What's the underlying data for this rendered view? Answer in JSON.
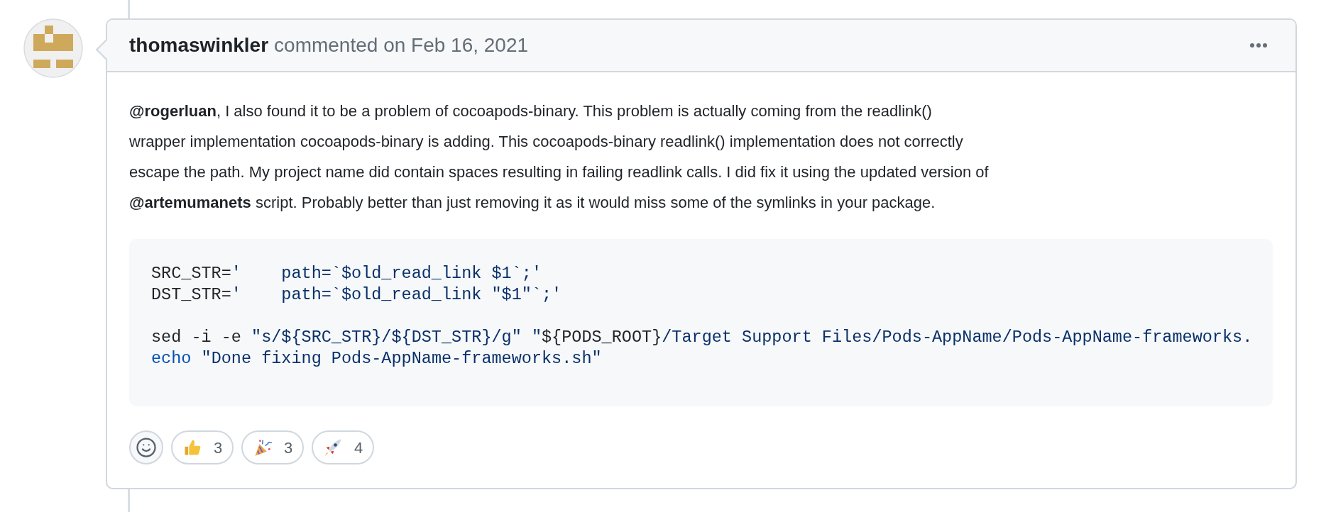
{
  "comment": {
    "author": "thomaswinkler",
    "action": "commented on Feb 16, 2021",
    "body": "**@rogerluan**, I also found it to be a problem of cocoapods-binary. This problem is actually coming from the readlink()\nwrapper implementation cocoapods-binary is adding. This cocoapods-binary readlink() implementation does not correctly\nescape the path. My project name did contain spaces resulting in failing readlink calls. I did fix it using the updated version of\n**@artemumanets** script. Probably better than just removing it as it would miss some of the symlinks in your package.",
    "code_groups": [
      [
        {
          "tokens": [
            {
              "kind": "plain",
              "text": "SRC_STR="
            },
            {
              "kind": "string",
              "text": "'    path=`$old_read_link $1`;'"
            }
          ]
        },
        {
          "tokens": [
            {
              "kind": "plain",
              "text": "DST_STR="
            },
            {
              "kind": "string",
              "text": "'    path=`$old_read_link \"$1\"`;'"
            }
          ]
        }
      ],
      [
        {
          "tokens": [
            {
              "kind": "plain",
              "text": "sed -i -e "
            },
            {
              "kind": "string",
              "text": "\"s/${SRC_STR}/${DST_STR}/g\" \""
            },
            {
              "kind": "plain",
              "text": "${PODS_ROOT}"
            },
            {
              "kind": "string",
              "text": "/Target Support Files/Pods-AppName/Pods-AppName-frameworks."
            }
          ]
        },
        {
          "tokens": [
            {
              "kind": "keyword",
              "text": "echo"
            },
            {
              "kind": "string",
              "text": " \"Done fixing Pods-AppName-frameworks.sh\""
            }
          ]
        }
      ]
    ],
    "reactions": [
      {
        "kind": "thumbs-up",
        "count": "3"
      },
      {
        "kind": "party",
        "count": "3"
      },
      {
        "kind": "rocket",
        "count": "4"
      }
    ]
  }
}
